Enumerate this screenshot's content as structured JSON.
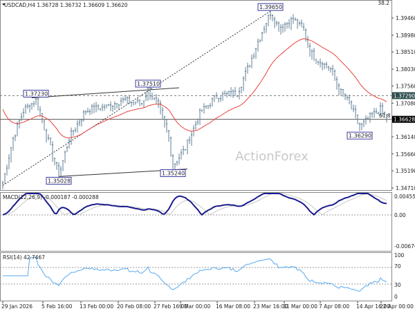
{
  "header": {
    "title": "USDCAD,H4 1.36728 1.36732 1.36609 1.36620"
  },
  "corner_label": "38.2",
  "fib_label": "61.8",
  "watermark": "ActionForex",
  "price_axis": {
    "ticks": [
      "1.39460",
      "1.38980",
      "1.38510",
      "1.38030",
      "1.37560",
      "1.37080",
      "1.36140",
      "1.35660",
      "1.35190",
      "1.34710"
    ],
    "tick_values": [
      1.3946,
      1.3898,
      1.3851,
      1.3803,
      1.3756,
      1.3708,
      1.3614,
      1.3566,
      1.3519,
      1.3471
    ],
    "marker_level": {
      "label": "1.37290",
      "value": 1.3729
    },
    "current_price": {
      "label": "1.36628",
      "value": 1.36628
    }
  },
  "annotations": [
    {
      "label": "1.37230",
      "value": 1.3723,
      "bar": 16
    },
    {
      "label": "1.35028",
      "value": 1.35028,
      "bar": 27
    },
    {
      "label": "1.37510",
      "value": 1.3751,
      "bar": 70
    },
    {
      "label": "1.35240",
      "value": 1.3524,
      "bar": 82
    },
    {
      "label": "1.39650",
      "value": 1.3965,
      "bar": 129
    },
    {
      "label": "1.36290",
      "value": 1.3629,
      "bar": 172
    }
  ],
  "macd": {
    "title": "MACD(12,26,9) -0.000187 -0.000288",
    "ticks": [
      "0.004552",
      "0.00",
      "-0.006764"
    ],
    "range": [
      -0.006764,
      0.004552
    ]
  },
  "rsi": {
    "title": "RSI(14) 42.7467",
    "ticks": [
      "100",
      "70",
      "30",
      "0"
    ],
    "levels": [
      70,
      30
    ]
  },
  "time_axis": [
    "29 Jan 2026",
    "5 Feb 16:00",
    "13 Feb 00:00",
    "20 Feb 08:00",
    "27 Feb 16:00",
    "9 Mar 00:00",
    "16 Mar 08:00",
    "23 Mar 16:00",
    "31 Mar 00:00",
    "7 Apr 08:00",
    "14 Apr 16:00",
    "22 Apr 00:00"
  ],
  "colors": {
    "bars": "#5f7f95",
    "ma": "#e8413c",
    "macd": "#1a1a8c",
    "signal": "#c8c8c8",
    "rsi": "#55a8f0"
  },
  "chart_data": {
    "type": "candlestick",
    "symbol": "USDCAD",
    "timeframe": "H4",
    "ylim": [
      1.3471,
      1.3985
    ],
    "waypoints": [
      {
        "bar": 0,
        "price": 1.3485
      },
      {
        "bar": 5,
        "price": 1.361
      },
      {
        "bar": 10,
        "price": 1.3687
      },
      {
        "bar": 16,
        "price": 1.3716
      },
      {
        "bar": 21,
        "price": 1.362
      },
      {
        "bar": 27,
        "price": 1.3504
      },
      {
        "bar": 32,
        "price": 1.361
      },
      {
        "bar": 40,
        "price": 1.3687
      },
      {
        "bar": 50,
        "price": 1.3697
      },
      {
        "bar": 57,
        "price": 1.3716
      },
      {
        "bar": 67,
        "price": 1.3707
      },
      {
        "bar": 70,
        "price": 1.3745
      },
      {
        "bar": 75,
        "price": 1.3697
      },
      {
        "bar": 80,
        "price": 1.361
      },
      {
        "bar": 82,
        "price": 1.3533
      },
      {
        "bar": 88,
        "price": 1.3581
      },
      {
        "bar": 95,
        "price": 1.3678
      },
      {
        "bar": 103,
        "price": 1.3726
      },
      {
        "bar": 113,
        "price": 1.3736
      },
      {
        "bar": 118,
        "price": 1.3803
      },
      {
        "bar": 123,
        "price": 1.388
      },
      {
        "bar": 129,
        "price": 1.3961
      },
      {
        "bar": 133,
        "price": 1.3919
      },
      {
        "bar": 140,
        "price": 1.3942
      },
      {
        "bar": 145,
        "price": 1.3909
      },
      {
        "bar": 148,
        "price": 1.3851
      },
      {
        "bar": 153,
        "price": 1.3822
      },
      {
        "bar": 158,
        "price": 1.3803
      },
      {
        "bar": 162,
        "price": 1.3745
      },
      {
        "bar": 167,
        "price": 1.3707
      },
      {
        "bar": 172,
        "price": 1.3639
      },
      {
        "bar": 177,
        "price": 1.3668
      },
      {
        "bar": 182,
        "price": 1.369
      },
      {
        "bar": 185,
        "price": 1.3662
      }
    ]
  }
}
